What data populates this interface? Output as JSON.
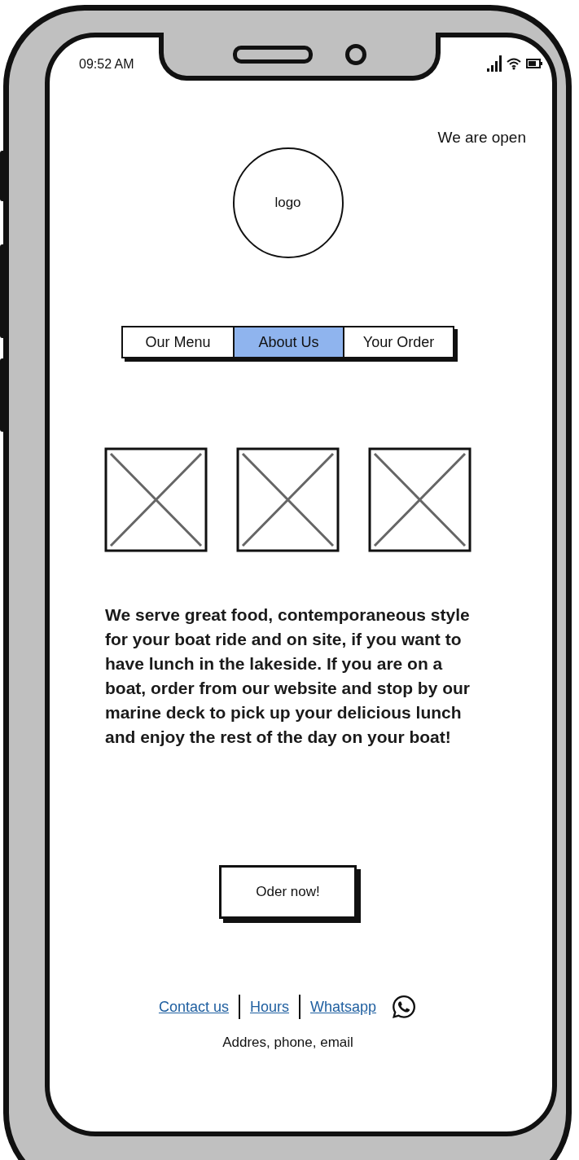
{
  "status_bar": {
    "time": "09:52 AM"
  },
  "open_status": "We are open",
  "logo": {
    "label": "logo"
  },
  "tabs": [
    {
      "label": "Our Menu",
      "selected": false
    },
    {
      "label": "About Us",
      "selected": true
    },
    {
      "label": "Your Order",
      "selected": false
    }
  ],
  "images": [
    {
      "kind": "placeholder"
    },
    {
      "kind": "placeholder"
    },
    {
      "kind": "placeholder"
    }
  ],
  "description": "We serve great food, contemporaneous style for your boat ride and on site, if you want to have lunch in the lakeside. If you are on a boat, order from our website and stop by our marine deck to pick up your delicious lunch and enjoy the rest of the day on your boat!",
  "order_button": "Oder now!",
  "footer": {
    "links": [
      {
        "label": "Contact us"
      },
      {
        "label": "Hours"
      },
      {
        "label": "Whatsapp"
      }
    ],
    "contact": "Addres, phone, email"
  }
}
